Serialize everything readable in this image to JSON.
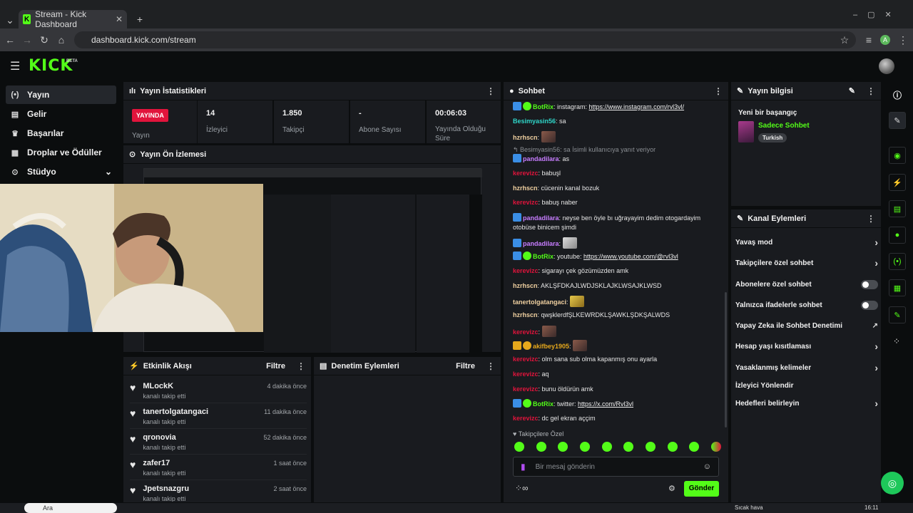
{
  "browser": {
    "tab_title": "Stream - Kick Dashboard",
    "url": "dashboard.kick.com/stream",
    "profile_initial": "A"
  },
  "header": {
    "logo": "KICK",
    "beta": "BETA"
  },
  "sidebar": {
    "items": [
      {
        "label": "Yayın",
        "icon": "broadcast-icon"
      },
      {
        "label": "Gelir",
        "icon": "revenue-icon"
      },
      {
        "label": "Başarılar",
        "icon": "trophy-icon"
      },
      {
        "label": "Droplar ve Ödüller",
        "icon": "gift-icon"
      },
      {
        "label": "Stüdyo",
        "icon": "studio-icon"
      }
    ]
  },
  "stats": {
    "title": "Yayın İstatistikleri",
    "live": "YAYINDA",
    "live_label": "Yayın",
    "items": [
      {
        "value": "14",
        "label": "İzleyici"
      },
      {
        "value": "1.850",
        "label": "Takipçi"
      },
      {
        "value": "-",
        "label": "Abone Sayısı"
      },
      {
        "value": "00:06:03",
        "label": "Yayında Olduğu Süre"
      }
    ]
  },
  "preview": {
    "title": "Yayın Ön İzlemesi"
  },
  "activity": {
    "title": "Etkinlik Akışı",
    "filter": "Filtre",
    "items": [
      {
        "name": "MLockK",
        "sub": "kanalı takip etti",
        "time": "4 dakika önce"
      },
      {
        "name": "tanertolgatangaci",
        "sub": "kanalı takip etti",
        "time": "11 dakika önce"
      },
      {
        "name": "qronovia",
        "sub": "kanalı takip etti",
        "time": "52 dakika önce"
      },
      {
        "name": "zafer17",
        "sub": "kanalı takip etti",
        "time": "1 saat önce"
      },
      {
        "name": "Jpetsnazgru",
        "sub": "kanalı takip etti",
        "time": "2 saat önce"
      }
    ]
  },
  "moderation": {
    "title": "Denetim Eylemleri",
    "filter": "Filtre"
  },
  "chat": {
    "title": "Sohbet",
    "reply_note": "Besimyasin56: sa İsimli kullanıcıya yanıt veriyor",
    "followers_only": "Takipçilere Özel",
    "placeholder": "Bir mesaj gönderin",
    "send": "Gönder",
    "messages": [
      {
        "user": "BotRix",
        "color": "#53fc18",
        "text": ": instagram: ",
        "link": "https://www.instagram.com/rvl3vl/"
      },
      {
        "user": "Besimyasin56",
        "color": "#2fd6c9",
        "text": ": sa"
      },
      {
        "user": "hzrhscn",
        "color": "#f0d0a0",
        "text": ":"
      },
      {
        "user": "pandadilara",
        "color": "#c77dff",
        "text": ": as"
      },
      {
        "user": "kerevizc",
        "color": "#e1143c",
        "text": ": babuşl"
      },
      {
        "user": "hzrhscn",
        "color": "#f0d0a0",
        "text": ": cücenin kanal bozuk"
      },
      {
        "user": "kerevizc",
        "color": "#e1143c",
        "text": ": babuş naber"
      },
      {
        "user": "pandadilara",
        "color": "#c77dff",
        "text": ": neyse ben öyle bı uğrayayim dedim otogardayim otobüse binicem şimdi"
      },
      {
        "user": "pandadilara",
        "color": "#c77dff",
        "text": ":"
      },
      {
        "user": "BotRix",
        "color": "#53fc18",
        "text": ": youtube: ",
        "link": "https://www.youtube.com/@rvl3vl"
      },
      {
        "user": "kerevizc",
        "color": "#e1143c",
        "text": ": sigarayı çek gözümüzden amk"
      },
      {
        "user": "hzrhscn",
        "color": "#f0d0a0",
        "text": ": AKLŞFDKAJLWDJSKLAJKLWSAJKLWSD"
      },
      {
        "user": "tanertolgatangaci",
        "color": "#f0d0a0",
        "text": ":"
      },
      {
        "user": "hzrhscn",
        "color": "#f0d0a0",
        "text": ": qwşklerdfŞLKEWRDKLŞAWKLŞDKŞALWDS"
      },
      {
        "user": "kerevizc",
        "color": "#e1143c",
        "text": ":"
      },
      {
        "user": "akifbey1905",
        "color": "#e6a81c",
        "text": ":"
      },
      {
        "user": "kerevizc",
        "color": "#e1143c",
        "text": ": olm sana sub olma kapanmış onu ayarla"
      },
      {
        "user": "kerevizc",
        "color": "#e1143c",
        "text": ": aq"
      },
      {
        "user": "kerevizc",
        "color": "#e1143c",
        "text": ": bunu öldürün amk"
      },
      {
        "user": "BotRix",
        "color": "#53fc18",
        "text": ": twitter: ",
        "link": "https://x.com/Rvl3vl"
      },
      {
        "user": "kerevizc",
        "color": "#e1143c",
        "text": ": dc gel ekran aççim"
      }
    ]
  },
  "stream_info": {
    "title": "Yayın bilgisi",
    "stream_title": "Yeni bir başangıç",
    "category": "Sadece Sohbet",
    "tag": "Turkish"
  },
  "channel_actions": {
    "title": "Kanal Eylemleri",
    "items": [
      {
        "label": "Yavaş mod",
        "ctrl": "chevron"
      },
      {
        "label": "Takipçilere özel sohbet",
        "ctrl": "chevron"
      },
      {
        "label": "Abonelere özel sohbet",
        "ctrl": "toggle"
      },
      {
        "label": "Yalnızca ifadelerle sohbet",
        "ctrl": "toggle"
      },
      {
        "label": "Yapay Zeka ile Sohbet Denetimi",
        "ctrl": "external"
      },
      {
        "label": "Hesap yaşı kısıtlaması",
        "ctrl": "chevron"
      },
      {
        "label": "Yasaklanmış kelimeler",
        "ctrl": "chevron"
      },
      {
        "label": "İzleyici Yönlendir",
        "ctrl": "none"
      },
      {
        "label": "Hedefleri belirleyin",
        "ctrl": "chevron"
      }
    ]
  },
  "taskbar": {
    "search": "Ara",
    "time": "16:11",
    "weather": "Sıcak hava"
  },
  "colors": {
    "accent": "#53fc18",
    "live": "#e1143c",
    "panel": "#191b1f",
    "bg": "#0b0d0e"
  }
}
